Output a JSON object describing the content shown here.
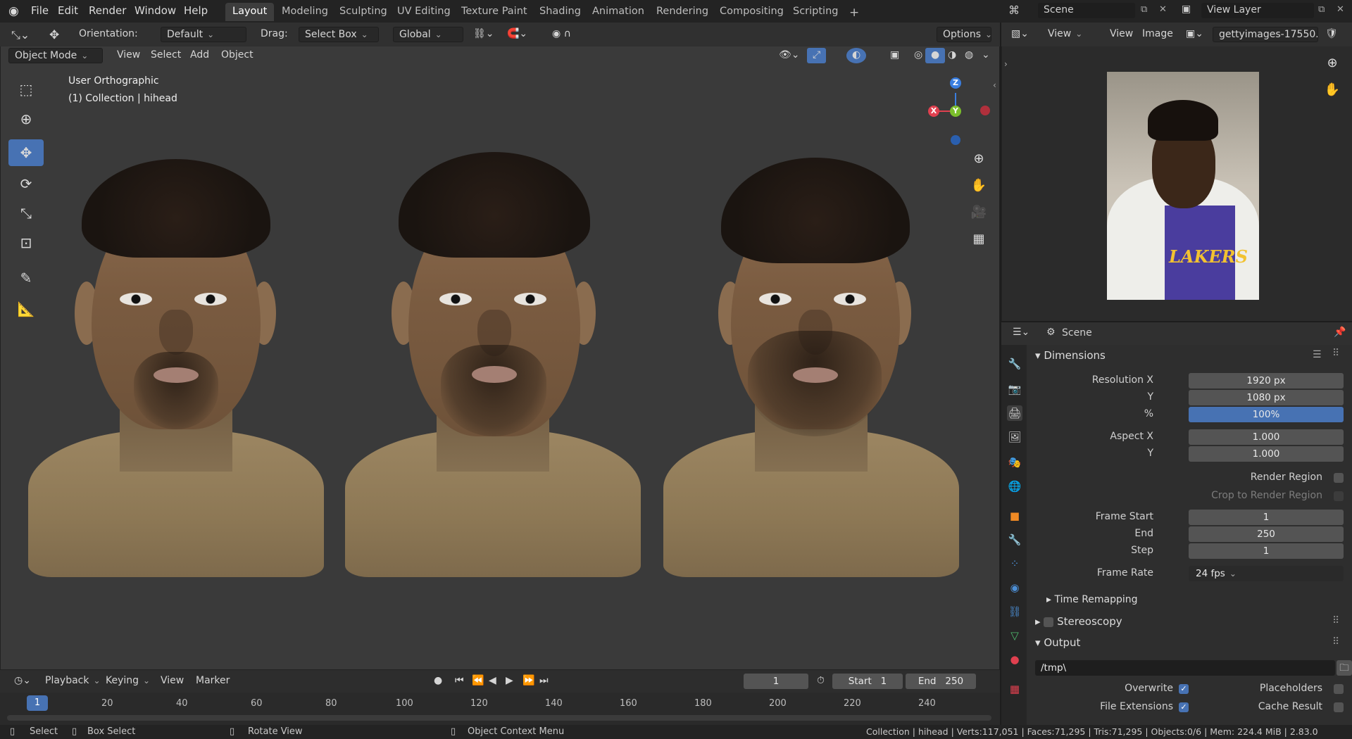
{
  "top_menu": {
    "items": [
      "File",
      "Edit",
      "Render",
      "Window",
      "Help"
    ],
    "workspaces": [
      "Layout",
      "Modeling",
      "Sculpting",
      "UV Editing",
      "Texture Paint",
      "Shading",
      "Animation",
      "Rendering",
      "Compositing",
      "Scripting"
    ],
    "add_label": "+",
    "scene_label": "Scene",
    "view_layer_label": "View Layer"
  },
  "viewport_header": {
    "orientation_label": "Orientation:",
    "orientation_value": "Default",
    "drag_label": "Drag:",
    "drag_value": "Select Box",
    "transform_value": "Global",
    "options_label": "Options",
    "mode_value": "Object Mode",
    "view_label": "View",
    "select_label": "Select",
    "add_label": "Add",
    "object_label": "Object"
  },
  "viewport": {
    "view_name": "User Orthographic",
    "collection_info": "(1) Collection | hihead",
    "gizmo": {
      "x": "X",
      "y": "Y",
      "z": "Z"
    }
  },
  "timeline": {
    "playback_label": "Playback",
    "keying_label": "Keying",
    "view_label": "View",
    "marker_label": "Marker",
    "current_frame": "1",
    "start_label": "Start",
    "start_value": "1",
    "end_label": "End",
    "end_value": "250",
    "ticks": [
      "1",
      "20",
      "40",
      "60",
      "80",
      "100",
      "120",
      "140",
      "160",
      "180",
      "200",
      "220",
      "240"
    ]
  },
  "image_editor": {
    "view_label": "View",
    "view2_label": "View",
    "image_label": "Image",
    "image_name": "gettyimages-17550..."
  },
  "properties": {
    "scene_label": "Scene",
    "dimensions_label": "Dimensions",
    "resolution_x_label": "Resolution X",
    "resolution_x": "1920 px",
    "y_label": "Y",
    "resolution_y": "1080 px",
    "percent_label": "%",
    "percent": "100%",
    "aspect_x_label": "Aspect X",
    "aspect_x": "1.000",
    "aspect_y_label": "Y",
    "aspect_y": "1.000",
    "render_region_label": "Render Region",
    "crop_label": "Crop to Render Region",
    "frame_start_label": "Frame Start",
    "frame_start": "1",
    "end_label": "End",
    "frame_end": "250",
    "step_label": "Step",
    "frame_step": "1",
    "frame_rate_label": "Frame Rate",
    "frame_rate": "24 fps",
    "time_remapping_label": "Time Remapping",
    "stereoscopy_label": "Stereoscopy",
    "output_label": "Output",
    "output_path": "/tmp\\",
    "overwrite_label": "Overwrite",
    "placeholders_label": "Placeholders",
    "file_extensions_label": "File Extensions",
    "cache_result_label": "Cache Result"
  },
  "statusbar": {
    "select_label": "Select",
    "box_select_label": "Box Select",
    "rotate_view_label": "Rotate View",
    "context_menu_label": "Object Context Menu",
    "stats": "Collection | hihead | Verts:117,051 | Faces:71,295 | Tris:71,295 | Objects:0/6 | Mem: 224.4 MiB | 2.83.0"
  },
  "photo": {
    "jersey_text": "LAKERS"
  },
  "colors": {
    "accent": "#4772b3",
    "axis_x": "#e0404f",
    "axis_y": "#7bbf2b",
    "axis_z": "#3a7ee0"
  }
}
